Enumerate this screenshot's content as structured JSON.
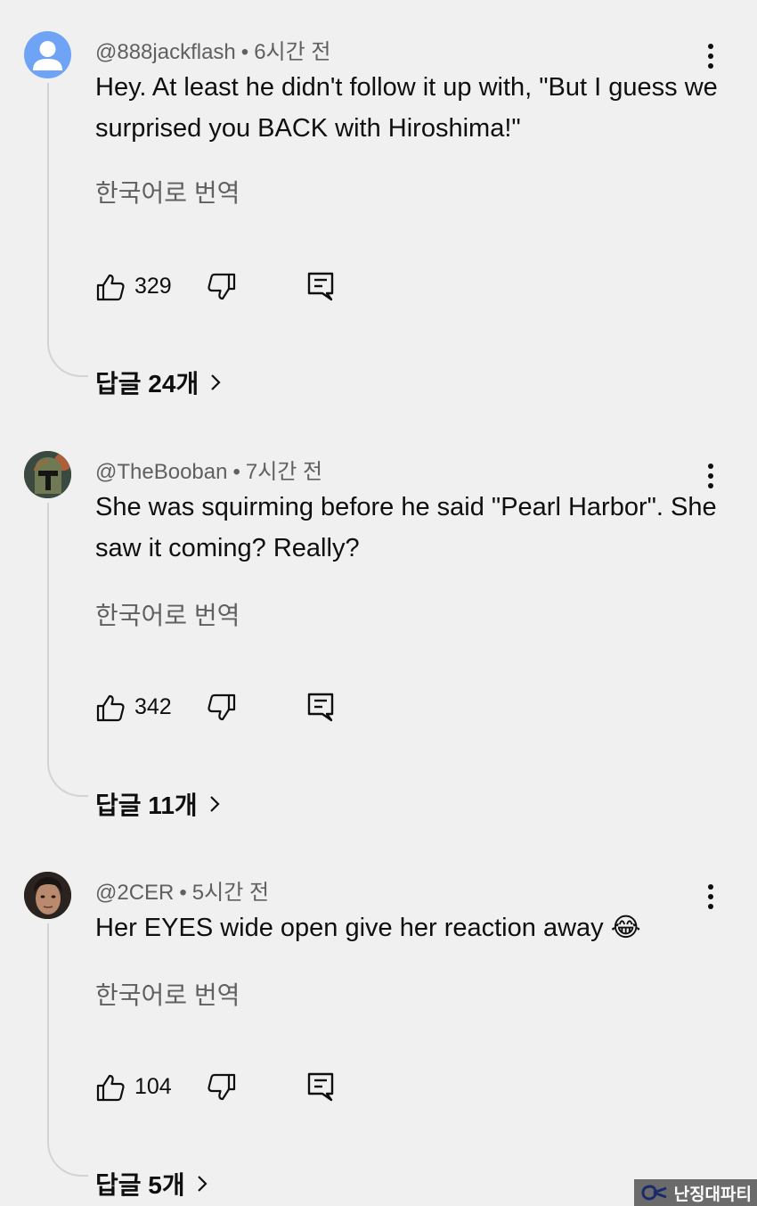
{
  "comments": [
    {
      "author": "@888jackflash",
      "time": "6시간 전",
      "text": "Hey. At least he didn't follow it up with, \"But I guess we surprised you BACK with Hiroshima!\"",
      "translate": "한국어로 번역",
      "likes": "329",
      "replies": "답글 24개",
      "avatar": "default-person-avatar"
    },
    {
      "author": "@TheBooban",
      "time": "7시간 전",
      "text": "She was squirming before he said \"Pearl Harbor\". She saw it coming? Really?",
      "translate": "한국어로 번역",
      "likes": "342",
      "replies": "답글 11개",
      "avatar": "helmet-avatar"
    },
    {
      "author": "@2CER",
      "time": "5시간 전",
      "text": "Her EYES wide open give her reaction away 😂",
      "translate": "한국어로 번역",
      "likes": "104",
      "replies": "답글 5개",
      "avatar": "face-avatar"
    }
  ],
  "separator": "•",
  "watermark": "난징대파티",
  "colors": {
    "background": "#f0f0f0",
    "secondary_text": "#606060",
    "thread_line": "#d3d3d3",
    "default_avatar": "#6ea3f5"
  }
}
